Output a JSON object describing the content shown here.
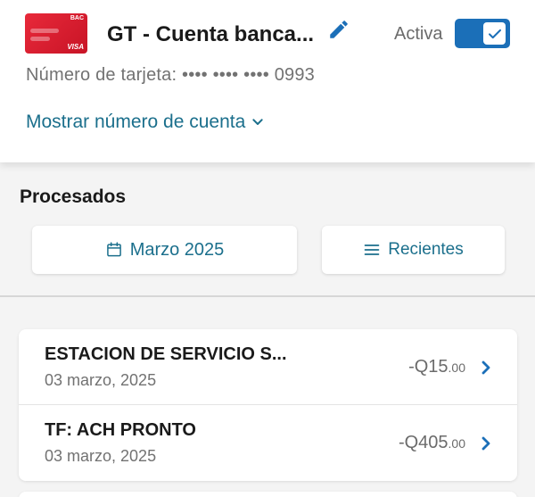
{
  "account": {
    "card_bank_logo": "BAC",
    "card_network": "VISA",
    "title": "GT - Cuenta banca...",
    "status_label": "Activa",
    "status_active": true,
    "card_number_label": "Número de tarjeta:",
    "card_number_masked": "•••• •••• •••• 0993",
    "show_account_label": "Mostrar número de cuenta"
  },
  "section": {
    "title": "Procesados"
  },
  "filters": {
    "month_label": "Marzo 2025",
    "order_label": "Recientes"
  },
  "transactions": [
    {
      "name": "ESTACION DE SERVICIO S...",
      "date": "03 marzo, 2025",
      "amount_main": "-Q15",
      "amount_cents": ".00"
    },
    {
      "name": "TF: ACH PRONTO",
      "date": "03 marzo, 2025",
      "amount_main": "-Q405",
      "amount_cents": ".00"
    }
  ],
  "colors": {
    "accent": "#1b6f8c",
    "toggle": "#1b6fb8",
    "card_red": "#d91c2e"
  },
  "icons": {
    "edit": "pencil-icon",
    "toggle_check": "check-icon",
    "expand": "chevron-down-icon",
    "calendar": "calendar-icon",
    "sort": "menu-lines-icon",
    "row_open": "chevron-right-icon"
  }
}
